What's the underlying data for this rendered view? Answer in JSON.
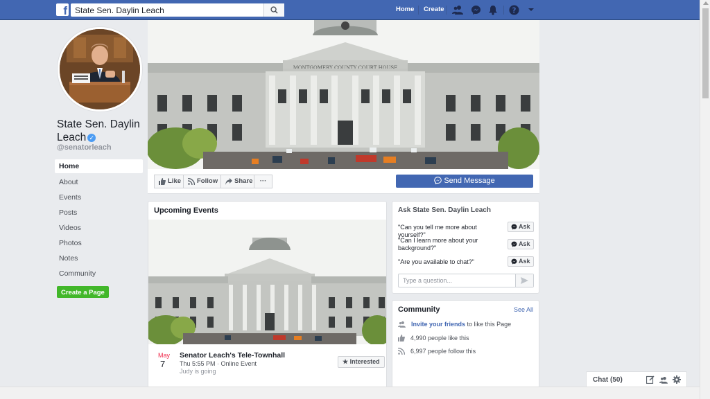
{
  "search": {
    "value": "State Sen. Daylin Leach",
    "placeholder": "Search"
  },
  "topnav": {
    "home": "Home",
    "create": "Create"
  },
  "profile": {
    "name": "State Sen. Daylin Leach",
    "handle": "@senatorleach"
  },
  "sidebar": {
    "items": [
      {
        "label": "Home",
        "active": true
      },
      {
        "label": "About"
      },
      {
        "label": "Events"
      },
      {
        "label": "Posts"
      },
      {
        "label": "Videos"
      },
      {
        "label": "Photos"
      },
      {
        "label": "Notes"
      },
      {
        "label": "Community"
      }
    ],
    "create_page": "Create a Page"
  },
  "cover": {
    "building_inscription": "MONTGOMERY COUNTY COURT HOUSE"
  },
  "actions": {
    "like": "Like",
    "follow": "Follow",
    "share": "Share",
    "more": "···",
    "send_message": "Send Message"
  },
  "events": {
    "title": "Upcoming Events",
    "item": {
      "month": "May",
      "day": "7",
      "name": "Senator Leach's Tele-Townhall",
      "meta": "Thu 5:55 PM · Online Event",
      "going": "Judy is going",
      "interested": "Interested"
    }
  },
  "ask": {
    "title": "Ask State Sen. Daylin Leach",
    "questions": [
      "\"Can you tell me more about yourself?\"",
      "\"Can I learn more about your background?\"",
      "\"Are you available to chat?\""
    ],
    "button": "Ask",
    "placeholder": "Type a question..."
  },
  "community": {
    "title": "Community",
    "see_all": "See All",
    "invite_link": "Invite your friends",
    "invite_rest": "to like this Page",
    "likes": "4,990 people like this",
    "follows": "6,997 people follow this"
  },
  "chat": {
    "label": "Chat (50)"
  },
  "colors": {
    "brand": "#4267b2",
    "green": "#42b72a",
    "event_red": "#f02849"
  }
}
